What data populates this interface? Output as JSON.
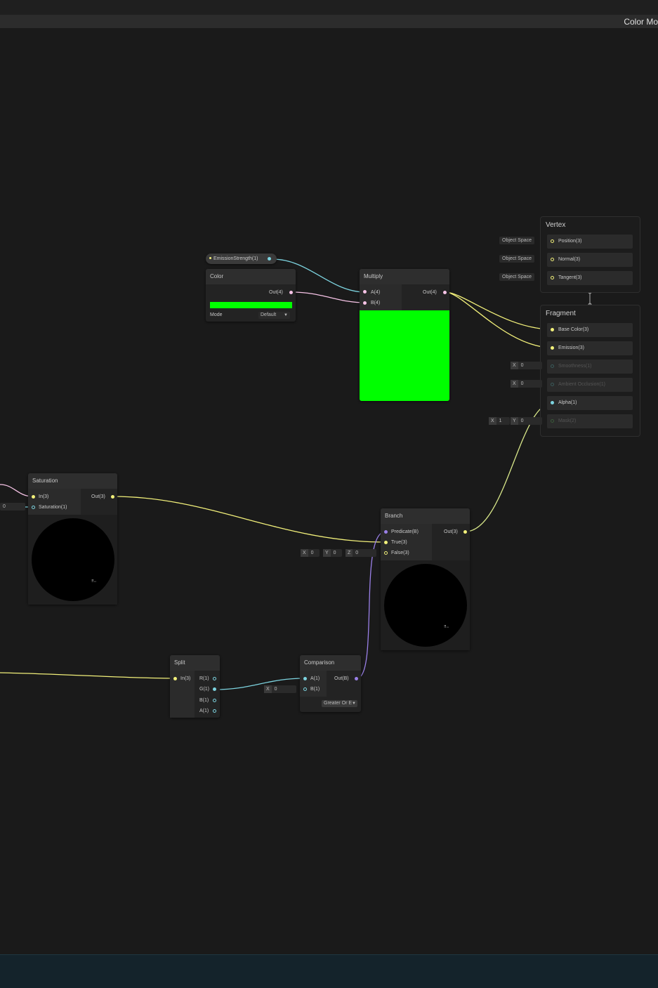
{
  "window": {
    "title": "Color Mo"
  },
  "nodes": {
    "property": {
      "name": "EmissionStrength(1)"
    },
    "color": {
      "title": "Color",
      "out": "Out(4)",
      "mode_label": "Mode",
      "mode_value": "Default",
      "swatch": "#00ff00"
    },
    "multiply": {
      "title": "Multiply",
      "in_a": "A(4)",
      "in_b": "B(4)",
      "out": "Out(4)",
      "preview_color": "#00ff00"
    },
    "saturation": {
      "title": "Saturation",
      "in": "In(3)",
      "sat": "Saturation(1)",
      "out": "Out(3)",
      "left_value": "0"
    },
    "branch": {
      "title": "Branch",
      "predicate": "Predicate(B)",
      "true": "True(3)",
      "false": "False(3)",
      "out": "Out(3)",
      "false_x_label": "X",
      "false_x": "0",
      "false_y_label": "Y",
      "false_y": "0",
      "false_z_label": "Z",
      "false_z": "0"
    },
    "split": {
      "title": "Split",
      "in": "In(3)",
      "r": "R(1)",
      "g": "G(1)",
      "b": "B(1)",
      "a": "A(1)"
    },
    "comparison": {
      "title": "Comparison",
      "in_a": "A(1)",
      "in_b": "B(1)",
      "out": "Out(B)",
      "b_x_label": "X",
      "b_x": "0",
      "op": "Greater Or E"
    }
  },
  "master": {
    "vertex": {
      "title": "Vertex",
      "space": "Object Space",
      "slots": [
        "Position(3)",
        "Normal(3)",
        "Tangent(3)"
      ]
    },
    "fragment": {
      "title": "Fragment",
      "slots": [
        "Base Color(3)",
        "Emission(3)",
        "Smoothness(1)",
        "Ambient Occlusion(1)",
        "Alpha(1)",
        "Mask(2)"
      ],
      "smoothness_x_label": "X",
      "smoothness_x": "0",
      "ao_x_label": "X",
      "ao_x": "0",
      "mask_x_label": "X",
      "mask_x": "1",
      "mask_y_label": "Y",
      "mask_y": "0"
    }
  },
  "colors": {
    "float": "#7dd4e0",
    "vector": "#f2f07a",
    "color": "#f6c3e6",
    "bool": "#9a80e8",
    "green": "#00ff00"
  }
}
